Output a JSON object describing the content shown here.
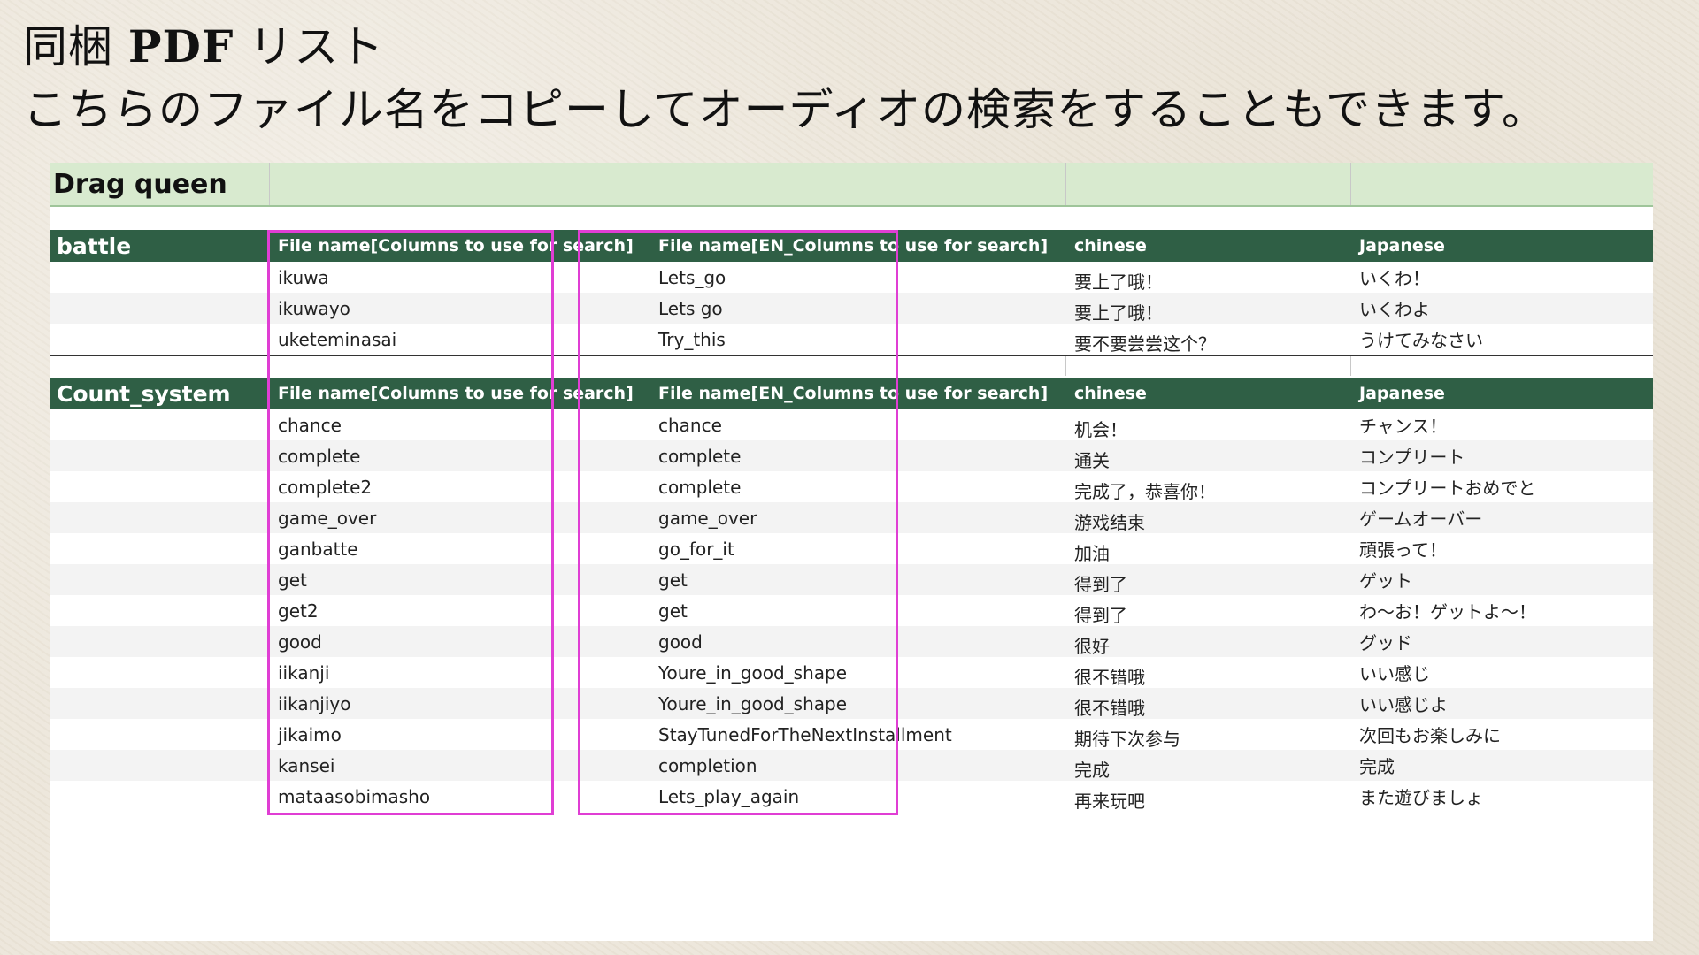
{
  "heading": {
    "title_prefix": "同梱 ",
    "title_pdf": "PDF",
    "title_suffix": " リスト",
    "subtitle": "こちらのファイル名をコピーしてオーディオの検索をすることもできます。"
  },
  "sheet": {
    "character": "Drag queen",
    "columns": {
      "file_name": "File name[Columns to use for search]",
      "en_name": "File name[EN_Columns to use for search]",
      "chinese": "chinese",
      "japanese": "Japanese"
    },
    "sections": [
      {
        "name": "battle",
        "rows": [
          [
            "ikuwa",
            "Lets_go",
            "要上了哦！",
            "いくわ！"
          ],
          [
            "ikuwayo",
            "Lets go",
            "要上了哦！",
            "いくわよ"
          ],
          [
            "uketeminasai",
            "Try_this",
            "要不要尝尝这个？",
            "うけてみなさい"
          ]
        ]
      },
      {
        "name": "Count_system",
        "rows": [
          [
            "chance",
            "chance",
            "机会！",
            "チャンス！"
          ],
          [
            "complete",
            "complete",
            "通关",
            "コンプリート"
          ],
          [
            "complete2",
            "complete",
            "完成了，恭喜你！",
            "コンプリートおめでと"
          ],
          [
            "game_over",
            "game_over",
            "游戏结束",
            "ゲームオーバー"
          ],
          [
            "ganbatte",
            "go_for_it",
            "加油",
            "頑張って！"
          ],
          [
            "get",
            "get",
            "得到了",
            "ゲット"
          ],
          [
            "get2",
            "get",
            "得到了",
            "わ～お！ゲットよ～！"
          ],
          [
            "good",
            "good",
            "很好",
            "グッド"
          ],
          [
            "iikanji",
            "Youre_in_good_shape",
            "很不错哦",
            "いい感じ"
          ],
          [
            "iikanjiyo",
            "Youre_in_good_shape",
            "很不错哦",
            "いい感じよ"
          ],
          [
            "jikaimo",
            "StayTunedForTheNextInstallment",
            "期待下次参与",
            "次回もお楽しみに"
          ],
          [
            "kansei",
            "completion",
            "完成",
            "完成"
          ],
          [
            "mataasobimasho",
            "Lets_play_again",
            "再来玩吧",
            "また遊びましょ"
          ]
        ]
      }
    ],
    "colors": {
      "header_bg": "#2f5f45",
      "title_bg": "#d8eacf",
      "highlight": "#e03ed4"
    }
  }
}
